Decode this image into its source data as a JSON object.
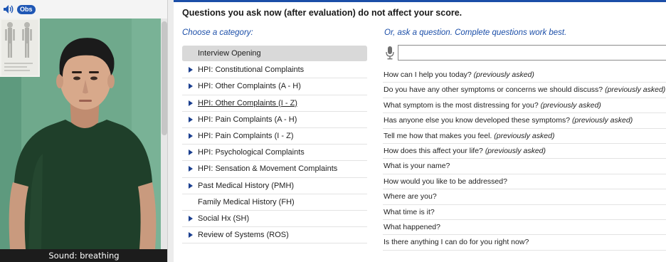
{
  "left_panel": {
    "obs_label": "Obs",
    "sound_caption": "Sound: breathing"
  },
  "header": {
    "notice": "Questions you ask now (after evaluation) do not affect your score.",
    "choose_category": "Choose a category:",
    "ask_hint": "Or, ask a question. Complete questions work best."
  },
  "search": {
    "value": "",
    "placeholder": ""
  },
  "categories": [
    {
      "label": "Interview Opening",
      "arrow": false,
      "selected": true,
      "underline": false
    },
    {
      "label": "HPI: Constitutional Complaints",
      "arrow": true,
      "selected": false,
      "underline": false
    },
    {
      "label": "HPI: Other Complaints (A - H)",
      "arrow": true,
      "selected": false,
      "underline": false
    },
    {
      "label": "HPI: Other Complaints (I - Z)",
      "arrow": true,
      "selected": false,
      "underline": true
    },
    {
      "label": "HPI: Pain Complaints (A - H)",
      "arrow": true,
      "selected": false,
      "underline": false
    },
    {
      "label": "HPI: Pain Complaints (I - Z)",
      "arrow": true,
      "selected": false,
      "underline": false
    },
    {
      "label": "HPI: Psychological Complaints",
      "arrow": true,
      "selected": false,
      "underline": false
    },
    {
      "label": "HPI: Sensation & Movement Complaints",
      "arrow": true,
      "selected": false,
      "underline": false
    },
    {
      "label": "Past Medical History (PMH)",
      "arrow": true,
      "selected": false,
      "underline": false
    },
    {
      "label": "Family Medical History (FH)",
      "arrow": false,
      "selected": false,
      "underline": false
    },
    {
      "label": "Social Hx (SH)",
      "arrow": true,
      "selected": false,
      "underline": false
    },
    {
      "label": "Review of Systems (ROS)",
      "arrow": true,
      "selected": false,
      "underline": false
    }
  ],
  "questions": [
    {
      "text": "How can I help you today?",
      "note": "(previously asked)"
    },
    {
      "text": "Do you have any other symptoms or concerns we should discuss?",
      "note": "(previously asked)"
    },
    {
      "text": "What symptom is the most distressing for you?",
      "note": "(previously asked)"
    },
    {
      "text": "Has anyone else you know developed these symptoms?",
      "note": "(previously asked)"
    },
    {
      "text": "Tell me how that makes you feel.",
      "note": "(previously asked)"
    },
    {
      "text": "How does this affect your life?",
      "note": "(previously asked)"
    },
    {
      "text": "What is your name?",
      "note": ""
    },
    {
      "text": "How would you like to be addressed?",
      "note": ""
    },
    {
      "text": "Where are you?",
      "note": ""
    },
    {
      "text": "What time is it?",
      "note": ""
    },
    {
      "text": "What happened?",
      "note": ""
    },
    {
      "text": "Is there anything I can do for you right now?",
      "note": ""
    }
  ],
  "colors": {
    "accent": "#1b4ea8",
    "selected_bg": "#d9d9d9",
    "wall": "#6fa98c",
    "shirt": "#1f3f2a"
  },
  "icons": [
    "speaker-icon",
    "microphone-icon",
    "expand-arrow-icon"
  ]
}
